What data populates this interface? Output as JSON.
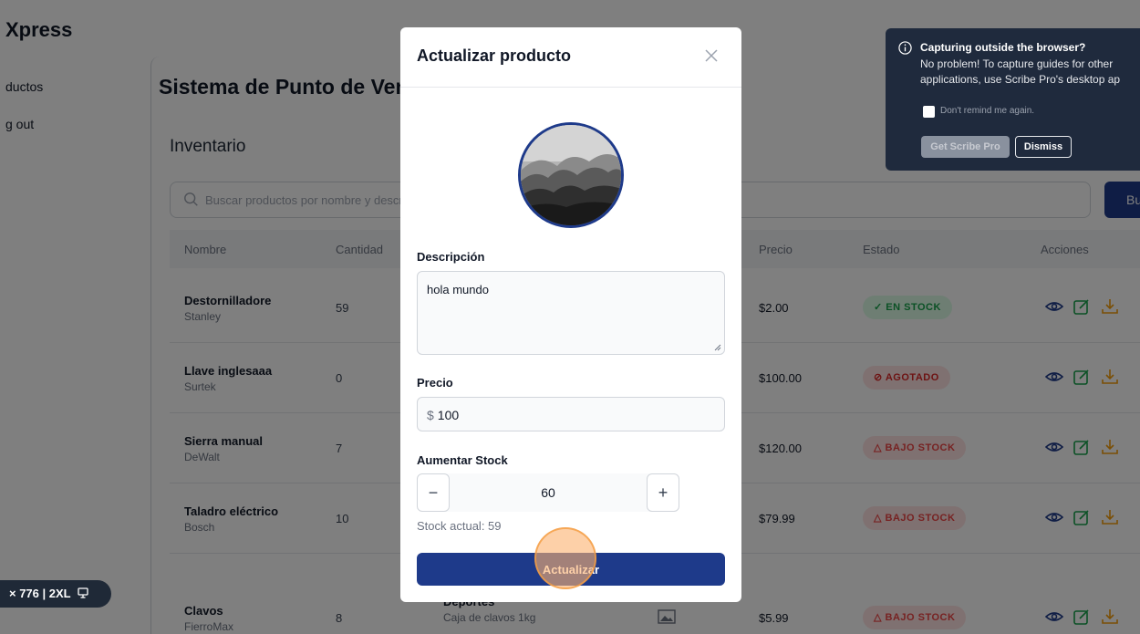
{
  "app": {
    "brand": "Xpress",
    "nav": {
      "products": "ductos",
      "logout": "g out"
    },
    "page_title": "Sistema de Punto de Venta",
    "section_title": "Inventario",
    "search": {
      "placeholder": "Buscar productos por nombre y descripción",
      "button": "Bu"
    },
    "table": {
      "headers": {
        "name": "Nombre",
        "qty": "Cantidad",
        "price": "Precio",
        "status": "Estado",
        "actions": "Acciones"
      },
      "rows": [
        {
          "name": "Destornilladore",
          "brand": "Stanley",
          "qty": "59",
          "price": "$2.00",
          "status": "✓ EN STOCK",
          "status_kind": "ok"
        },
        {
          "name": "Llave inglesaaa",
          "brand": "Surtek",
          "qty": "0",
          "price": "$100.00",
          "status": "⊘ AGOTADO",
          "status_kind": "out"
        },
        {
          "name": "Sierra manual",
          "brand": "DeWalt",
          "qty": "7",
          "price": "$120.00",
          "status": "△ BAJO STOCK",
          "status_kind": "low"
        },
        {
          "name": "Taladro eléctrico",
          "brand": "Bosch",
          "qty": "10",
          "price": "$79.99",
          "status": "△ BAJO STOCK",
          "status_kind": "low"
        },
        {
          "name": "Clavos",
          "brand": "FierroMax",
          "qty": "8",
          "category": "Deportes",
          "category_sub": "Caja de clavos 1kg",
          "price": "$5.99",
          "status": "△ BAJO STOCK",
          "status_kind": "low"
        }
      ]
    },
    "viewport_badge": "× 776 | 2XL"
  },
  "scribe": {
    "title": "Capturing outside the browser?",
    "body": "No problem! To capture guides for other applications, use Scribe Pro's desktop ap",
    "checkbox_label": "Don't remind me again.",
    "pro_button": "Get Scribe Pro",
    "dismiss_button": "Dismiss"
  },
  "modal": {
    "title": "Actualizar producto",
    "description_label": "Descripción",
    "description_value": "hola mundo",
    "price_label": "Precio",
    "price_symbol": "$",
    "price_value": "100",
    "stock_label": "Aumentar Stock",
    "stock_minus": "−",
    "stock_plus": "+",
    "stock_value": "60",
    "stock_current": "Stock actual: 59",
    "submit_button": "Actualizar"
  },
  "colors": {
    "primary": "#1e3a8a",
    "scribe_bg": "#1f2a3d",
    "status_ok": "#16a34a",
    "status_out": "#dc2626",
    "click_highlight": "#fbb06e"
  }
}
